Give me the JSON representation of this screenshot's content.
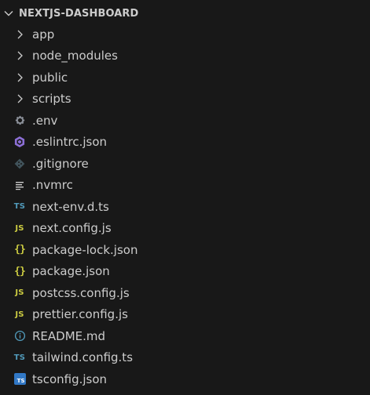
{
  "explorer": {
    "section_title": "NEXTJS-DASHBOARD",
    "items": [
      {
        "type": "folder",
        "label": "app",
        "icon": "chevron-right-icon"
      },
      {
        "type": "folder",
        "label": "node_modules",
        "icon": "chevron-right-icon"
      },
      {
        "type": "folder",
        "label": "public",
        "icon": "chevron-right-icon"
      },
      {
        "type": "folder",
        "label": "scripts",
        "icon": "chevron-right-icon"
      },
      {
        "type": "file",
        "label": ".env",
        "icon": "gear-icon"
      },
      {
        "type": "file",
        "label": ".eslintrc.json",
        "icon": "eslint-icon"
      },
      {
        "type": "file",
        "label": ".gitignore",
        "icon": "git-icon"
      },
      {
        "type": "file",
        "label": ".nvmrc",
        "icon": "lines-icon"
      },
      {
        "type": "file",
        "label": "next-env.d.ts",
        "icon": "typescript-icon",
        "badge": "TS"
      },
      {
        "type": "file",
        "label": "next.config.js",
        "icon": "javascript-icon",
        "badge": "JS"
      },
      {
        "type": "file",
        "label": "package-lock.json",
        "icon": "json-icon",
        "badge": "{}"
      },
      {
        "type": "file",
        "label": "package.json",
        "icon": "json-icon",
        "badge": "{}"
      },
      {
        "type": "file",
        "label": "postcss.config.js",
        "icon": "javascript-icon",
        "badge": "JS"
      },
      {
        "type": "file",
        "label": "prettier.config.js",
        "icon": "javascript-icon",
        "badge": "JS"
      },
      {
        "type": "file",
        "label": "README.md",
        "icon": "info-icon"
      },
      {
        "type": "file",
        "label": "tailwind.config.ts",
        "icon": "typescript-icon",
        "badge": "TS"
      },
      {
        "type": "file",
        "label": "tsconfig.json",
        "icon": "tsconfig-icon",
        "badge": "TS"
      }
    ]
  },
  "colors": {
    "background": "#181818",
    "text": "#cccccc",
    "ts_blue": "#519aba",
    "js_yellow": "#cbcb41",
    "eslint_purple": "#8c6fd6",
    "tsconfig_box": "#3178c6"
  }
}
